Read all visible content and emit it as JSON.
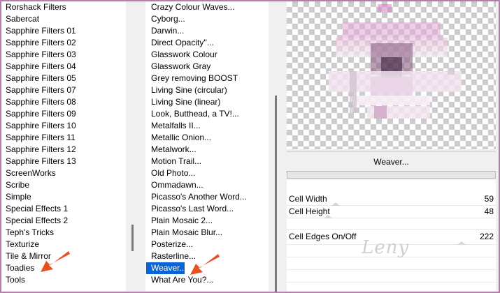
{
  "category_list": {
    "items": [
      "Rorshack Filters",
      "Sabercat",
      "Sapphire Filters 01",
      "Sapphire Filters 02",
      "Sapphire Filters 03",
      "Sapphire Filters 04",
      "Sapphire Filters 05",
      "Sapphire Filters 07",
      "Sapphire Filters 08",
      "Sapphire Filters 09",
      "Sapphire Filters 10",
      "Sapphire Filters 11",
      "Sapphire Filters 12",
      "Sapphire Filters 13",
      "ScreenWorks",
      "Scribe",
      "Simple",
      "Special Effects 1",
      "Special Effects 2",
      "Teph's Tricks",
      "Texturize",
      "Tile & Mirror",
      "Toadies",
      "Tools"
    ],
    "pointed_item": "Toadies"
  },
  "filter_list": {
    "items": [
      "Crazy Colour Waves...",
      "Cyborg...",
      "Darwin...",
      "Direct Opacity''...",
      "Glasswork Colour",
      "Glasswork Gray",
      "Grey removing BOOST",
      "Living Sine (circular)",
      "Living Sine (linear)",
      "Look, Butthead, a TV!...",
      "Metalfalls II...",
      "Metallic Onion...",
      "Metalwork...",
      "Motion Trail...",
      "Old Photo...",
      "Ommadawn...",
      "Picasso's Another Word...",
      "Picasso's Last Word...",
      "Plain Mosaic 2...",
      "Plain Mosaic Blur...",
      "Posterize...",
      "Rasterline...",
      "Weaver...",
      "What Are You?..."
    ],
    "selected": "Weaver..."
  },
  "filter_panel": {
    "name": "Weaver...",
    "params": [
      {
        "label": "Cell Width",
        "value": "59",
        "fraction": 0.23
      },
      {
        "label": "Cell Height",
        "value": "48",
        "fraction": 0.19
      },
      {
        "label": "Cell Edges On/Off",
        "value": "222",
        "fraction": 0.87
      }
    ],
    "watermark": "Leny"
  },
  "colors": {
    "frame": "#b97ab0",
    "selection": "#0a64d6",
    "arrow": "#e8501e"
  }
}
